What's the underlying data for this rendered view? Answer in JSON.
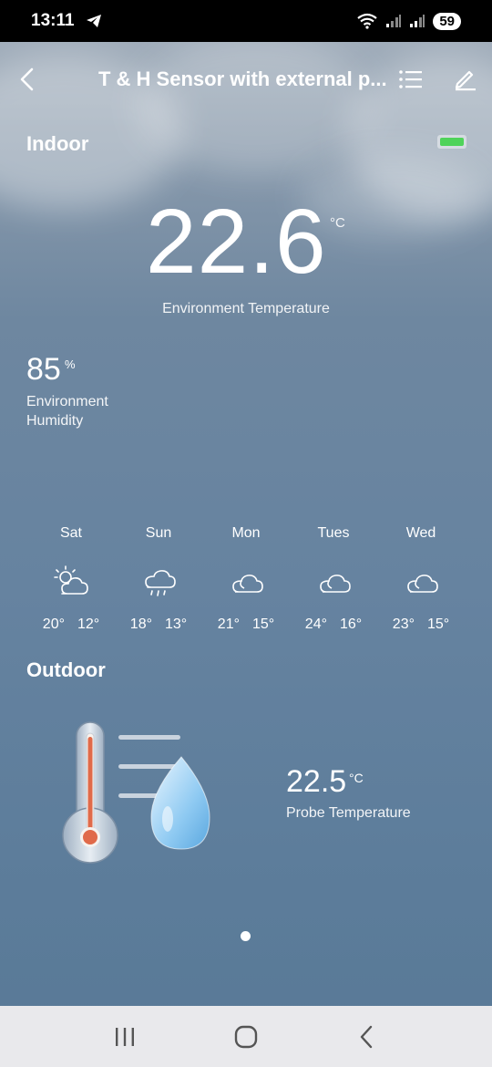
{
  "status_bar": {
    "time": "13:11",
    "battery": "59"
  },
  "header": {
    "title": "T & H Sensor with external p..."
  },
  "indoor": {
    "section_label": "Indoor",
    "temperature": "22.6",
    "temperature_unit": "°C",
    "temperature_label": "Environment Temperature",
    "humidity": "85",
    "humidity_unit": "%",
    "humidity_label": "Environment Humidity",
    "battery_status_color": "#4fd35a"
  },
  "forecast": [
    {
      "day": "Sat",
      "icon": "partly-cloudy-icon",
      "high": "20°",
      "low": "12°"
    },
    {
      "day": "Sun",
      "icon": "rain-cloud-icon",
      "high": "18°",
      "low": "13°"
    },
    {
      "day": "Mon",
      "icon": "cloud-icon",
      "high": "21°",
      "low": "15°"
    },
    {
      "day": "Tues",
      "icon": "cloud-icon",
      "high": "24°",
      "low": "16°"
    },
    {
      "day": "Wed",
      "icon": "cloud-icon",
      "high": "23°",
      "low": "15°"
    }
  ],
  "outdoor": {
    "section_label": "Outdoor",
    "probe_temperature": "22.5",
    "probe_unit": "°C",
    "probe_label": "Probe Temperature"
  },
  "pager": {
    "page_count": 1,
    "current_page": 1
  }
}
